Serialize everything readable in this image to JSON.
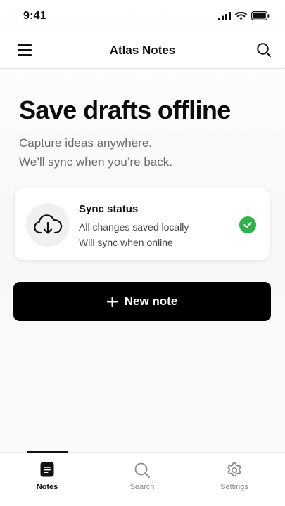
{
  "status_bar": {
    "time": "9:41"
  },
  "nav": {
    "title": "Atlas Notes",
    "menu_icon": "menu-icon",
    "search_icon": "search-icon"
  },
  "hero": {
    "title": "Save drafts offline",
    "subtitle_line1": "Capture ideas anywhere.",
    "subtitle_line2": "We’ll sync when you’re back."
  },
  "sync_card": {
    "title": "Sync status",
    "line1": "All changes saved locally",
    "line2": "Will sync when online",
    "icon": "cloud-download-icon",
    "status_icon": "check-circle-icon",
    "status_color": "#2fb24a"
  },
  "primary_action": {
    "label": "New note",
    "icon": "plus-icon"
  },
  "tabs": [
    {
      "label": "Notes",
      "icon": "note-icon",
      "active": true
    },
    {
      "label": "Search",
      "icon": "search-icon",
      "active": false
    },
    {
      "label": "Settings",
      "icon": "gear-icon",
      "active": false
    }
  ]
}
